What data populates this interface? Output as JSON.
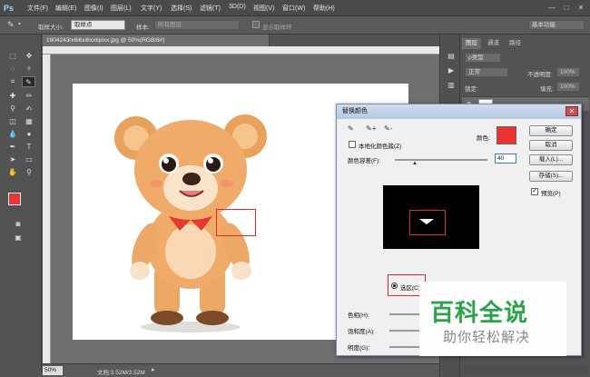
{
  "menubar": {
    "logo": "Ps",
    "items": [
      "文件(F)",
      "编辑(E)",
      "图像(I)",
      "图层(L)",
      "文字(Y)",
      "选择(S)",
      "滤镜(T)",
      "3D(D)",
      "视图(V)",
      "窗口(W)",
      "帮助(H)"
    ],
    "minimize": "—",
    "restore": "□",
    "close": "✕"
  },
  "options": {
    "sample_size_label": "取样大小:",
    "sample_size_value": "取样点",
    "sample_label": "样本:",
    "sample_value": "所有图层",
    "show_ring_label": "显示取样环",
    "workspace": "基本功能"
  },
  "document": {
    "tab_title": "1904243rx6i6xi6xx6pixx.jpg @ 50%(RGB/8#)",
    "zoom": "50%",
    "doc_size": "文档:3.52M/3.52M"
  },
  "panel": {
    "tabs": [
      "图层",
      "通道",
      "路径"
    ],
    "kind_label": "ρ类型",
    "blend_mode": "正常",
    "opacity_label": "不透明度:",
    "opacity_value": "100%",
    "lock_label": "锁定:",
    "fill_label": "填充:",
    "fill_value": "100%"
  },
  "dialog": {
    "title": "替换颜色",
    "localized_label": "本地化颜色簇(Z)",
    "color_label": "颜色:",
    "fuzziness_label": "颜色容差(F):",
    "fuzziness_value": "40",
    "selection_radio": "选区(C)",
    "hue_label": "色相(H):",
    "saturation_label": "饱和度(A):",
    "lightness_label": "明度(G):",
    "ok": "确定",
    "cancel": "取消",
    "load": "载入(L)...",
    "save": "存储(S)...",
    "preview_label": "预览(P)",
    "selected_color": "#e83434",
    "close_glyph": "✕",
    "eyedroppers": [
      "✎",
      "✎+",
      "✎-"
    ]
  },
  "watermark": {
    "title": "百科全说",
    "subtitle": "助你轻松解决",
    "title_color": "#2aa44a"
  }
}
